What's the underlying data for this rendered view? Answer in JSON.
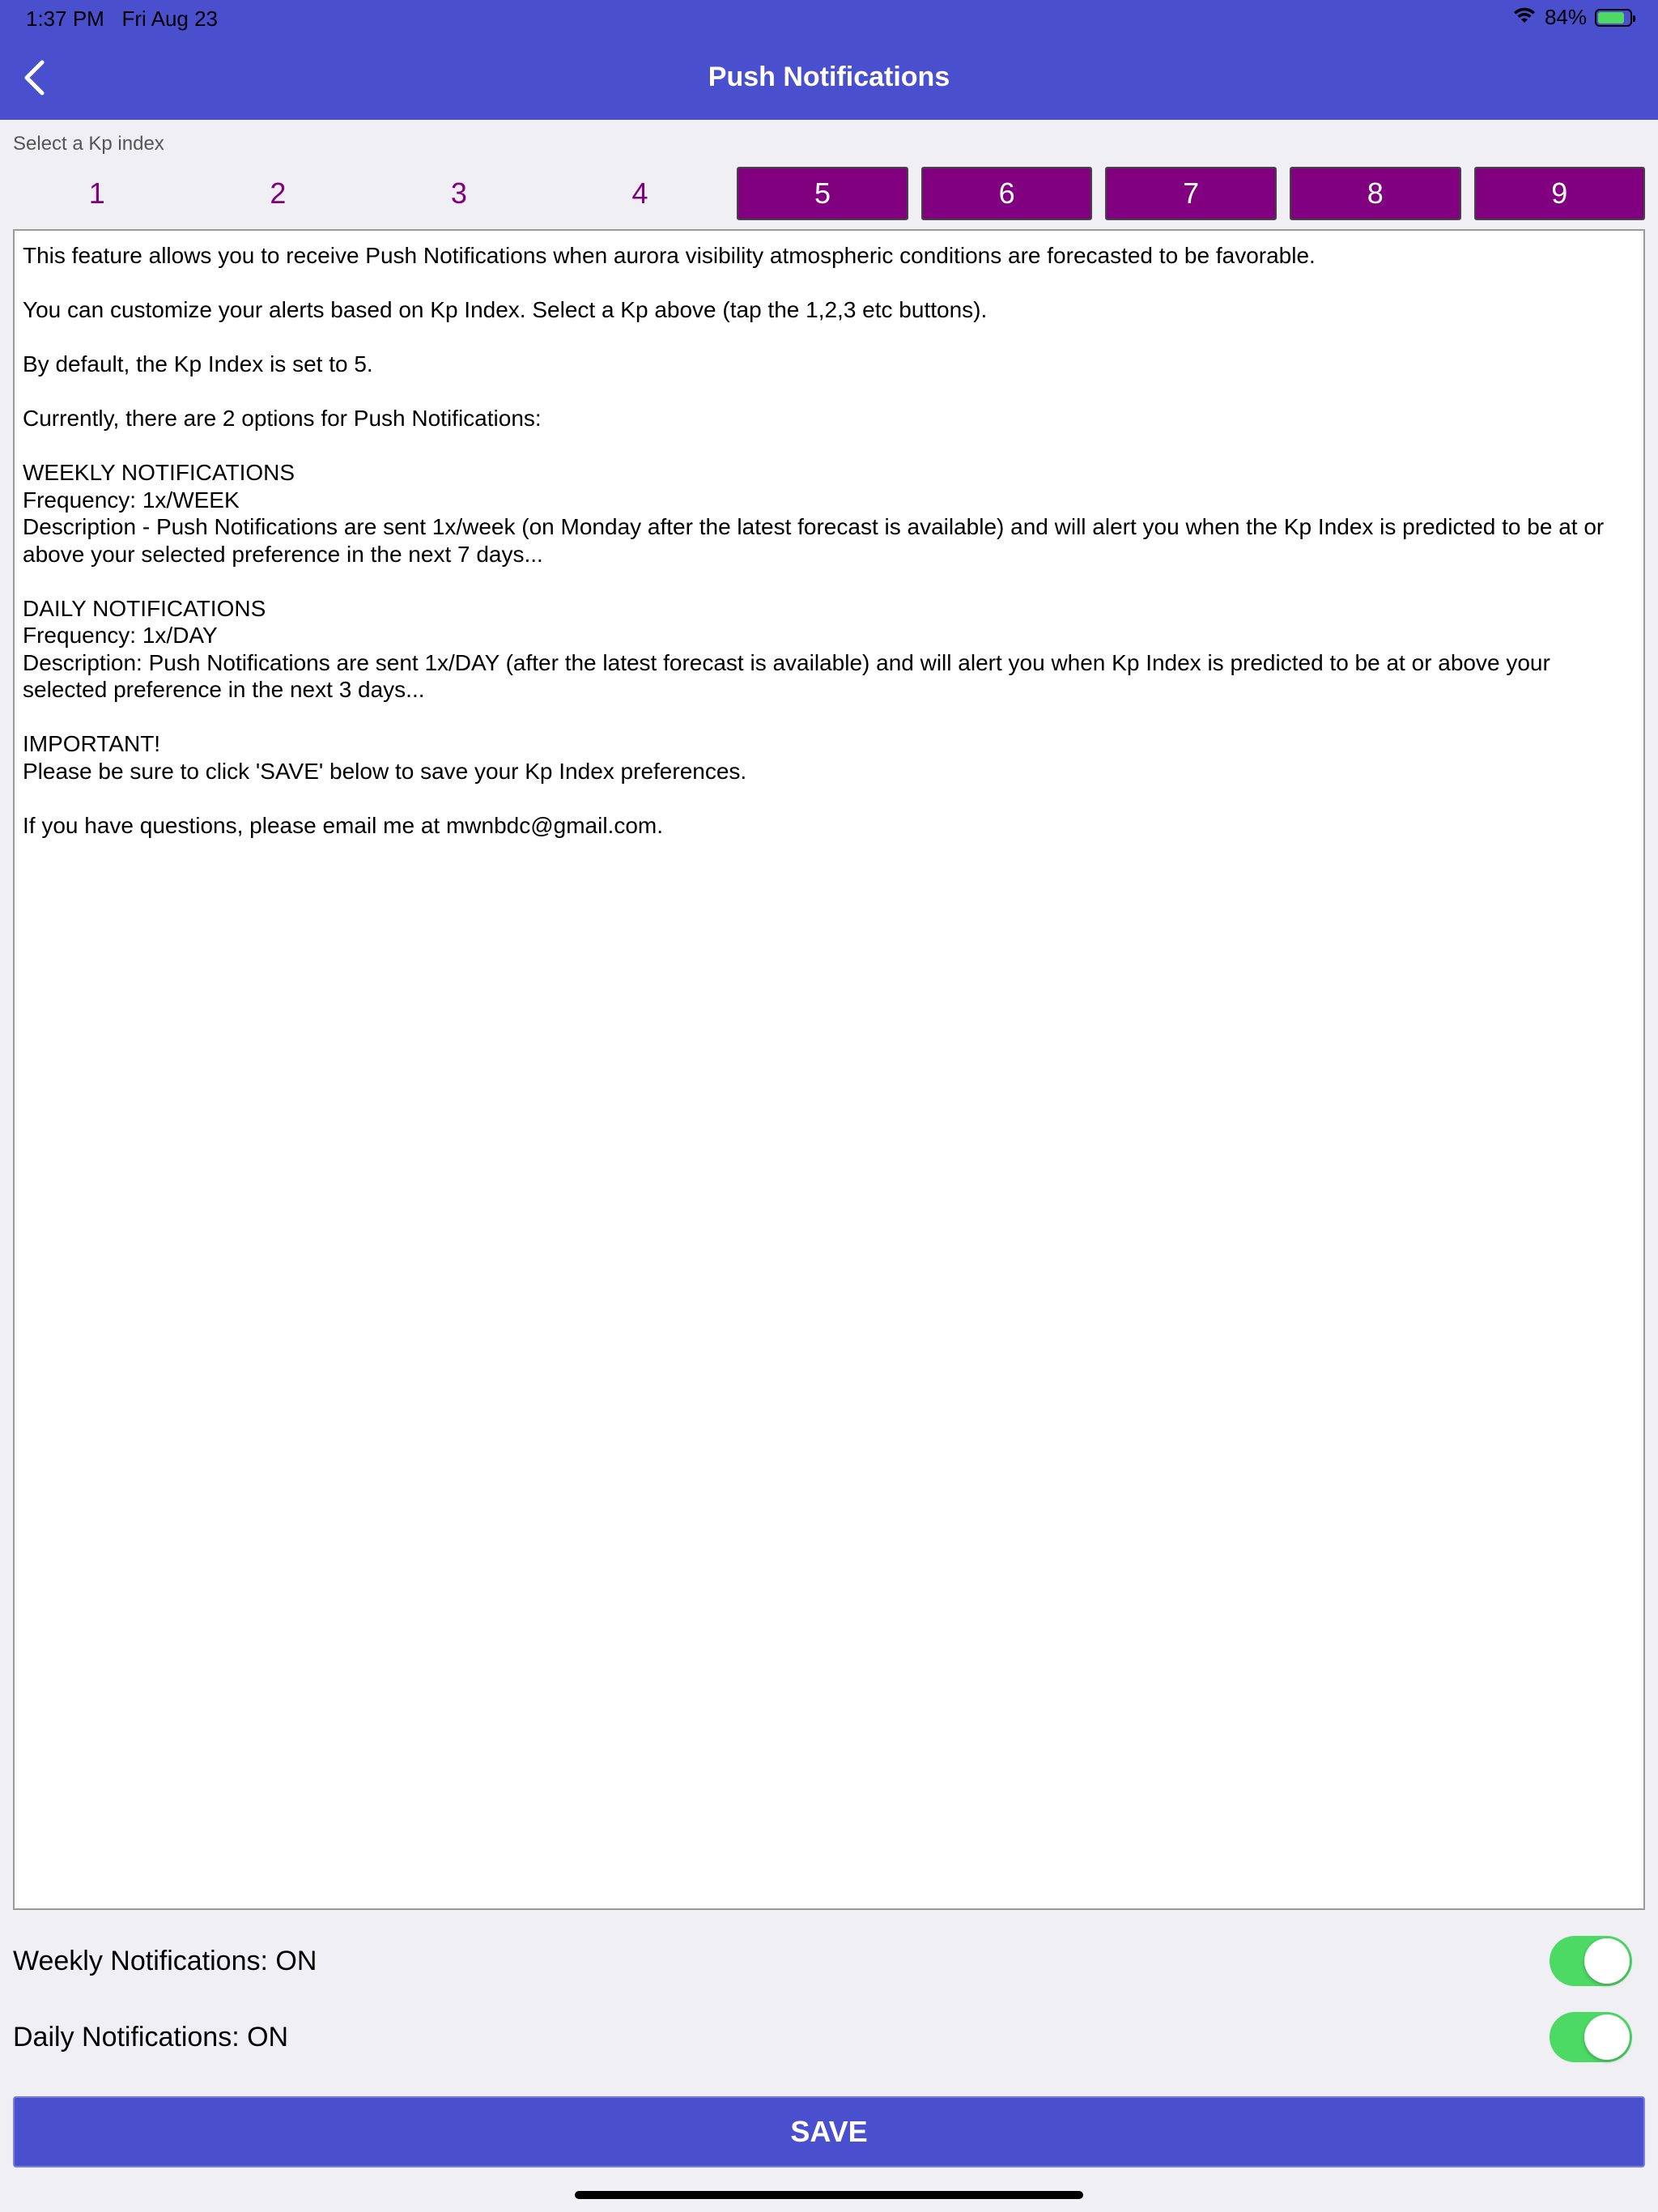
{
  "status_bar": {
    "time": "1:37 PM",
    "date": "Fri Aug 23",
    "battery_percent": "84%",
    "battery_level": 0.84,
    "battery_color": "#4cd964"
  },
  "header": {
    "title": "Push Notifications",
    "back_icon": "chevron-left-icon",
    "background_color": "#4a4fcd"
  },
  "kp_selector": {
    "label": "Select a Kp index",
    "selected": 5,
    "accent_color": "#800080",
    "buttons": [
      {
        "label": "1",
        "active": false
      },
      {
        "label": "2",
        "active": false
      },
      {
        "label": "3",
        "active": false
      },
      {
        "label": "4",
        "active": false
      },
      {
        "label": "5",
        "active": true
      },
      {
        "label": "6",
        "active": true
      },
      {
        "label": "7",
        "active": true
      },
      {
        "label": "8",
        "active": true
      },
      {
        "label": "9",
        "active": true
      }
    ]
  },
  "info": {
    "text": "This feature allows you to receive Push Notifications when aurora visibility atmospheric conditions are forecasted to be favorable.\n\nYou can customize your alerts based on Kp Index. Select a Kp above (tap the 1,2,3 etc buttons).\n\nBy default, the Kp Index is set to 5.\n\nCurrently, there are 2 options for Push Notifications:\n\nWEEKLY NOTIFICATIONS\nFrequency: 1x/WEEK\nDescription - Push Notifications are sent 1x/week (on Monday after the latest forecast is available) and will alert you when the Kp Index is predicted to be at or above your selected preference in the next 7 days...\n\nDAILY NOTIFICATIONS\nFrequency: 1x/DAY\nDescription: Push Notifications are sent 1x/DAY (after the latest forecast is available) and will alert you when Kp Index is predicted to be at or above your selected preference in the next 3 days...\n\nIMPORTANT!\nPlease be sure to click 'SAVE' below to save your Kp Index preferences.\n\nIf you have questions, please email me at mwnbdc@gmail.com."
  },
  "toggles": {
    "weekly": {
      "label": "Weekly Notifications: ON",
      "on": true
    },
    "daily": {
      "label": "Daily Notifications: ON",
      "on": true
    },
    "on_color": "#4cd964"
  },
  "save": {
    "label": "SAVE"
  }
}
